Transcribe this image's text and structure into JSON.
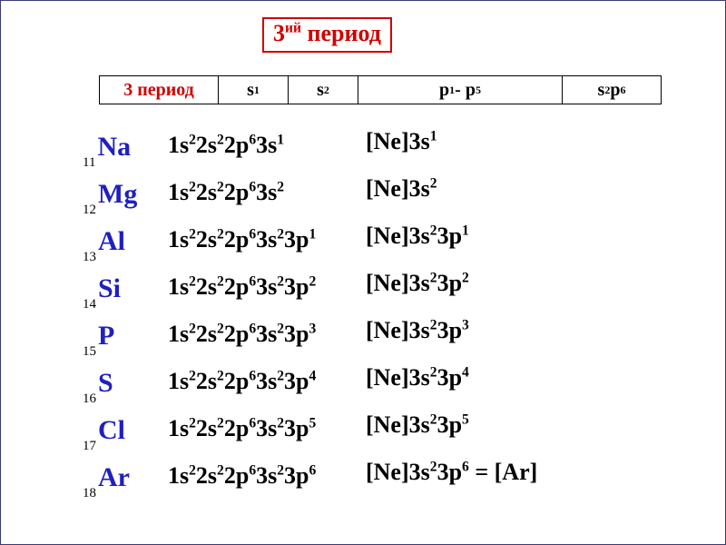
{
  "title": {
    "base": "3",
    "superscript": "ий",
    "rest": " период"
  },
  "header": {
    "period_label": "3 период",
    "cells": [
      {
        "base": "s",
        "sup": "1"
      },
      {
        "base": "s",
        "sup": "2"
      },
      {
        "text_parts": [
          {
            "t": "p",
            "sup": "1"
          },
          {
            "t": " - p",
            "sup": "5"
          }
        ]
      },
      {
        "text_parts": [
          {
            "t": "s",
            "sup": "2"
          },
          {
            "t": "p",
            "sup": "6"
          }
        ]
      }
    ]
  },
  "elements": [
    {
      "z": "11",
      "symbol": "Na",
      "full": [
        {
          "t": "1s",
          "sup": "2"
        },
        {
          "t": "2s",
          "sup": "2"
        },
        {
          "t": "2p",
          "sup": "6"
        },
        {
          "t": "3s",
          "sup": "1"
        }
      ],
      "short": [
        {
          "t": "[Ne]3s",
          "sup": "1"
        }
      ]
    },
    {
      "z": "12",
      "symbol": "Mg",
      "full": [
        {
          "t": "1s",
          "sup": "2"
        },
        {
          "t": "2s",
          "sup": "2"
        },
        {
          "t": "2p",
          "sup": "6"
        },
        {
          "t": "3s",
          "sup": "2"
        }
      ],
      "short": [
        {
          "t": "[Ne]3s",
          "sup": "2"
        }
      ]
    },
    {
      "z": "13",
      "symbol": "Al",
      "full": [
        {
          "t": "1s",
          "sup": "2"
        },
        {
          "t": "2s",
          "sup": "2"
        },
        {
          "t": "2p",
          "sup": "6"
        },
        {
          "t": "3s",
          "sup": "2"
        },
        {
          "t": "3p",
          "sup": "1"
        }
      ],
      "short": [
        {
          "t": "[Ne]3s",
          "sup": "2"
        },
        {
          "t": "3p",
          "sup": "1"
        }
      ]
    },
    {
      "z": "14",
      "symbol": "Si",
      "full": [
        {
          "t": "1s",
          "sup": "2"
        },
        {
          "t": "2s",
          "sup": "2"
        },
        {
          "t": "2p",
          "sup": "6"
        },
        {
          "t": "3s",
          "sup": "2"
        },
        {
          "t": "3p",
          "sup": "2"
        }
      ],
      "short": [
        {
          "t": "[Ne]3s",
          "sup": "2"
        },
        {
          "t": "3p",
          "sup": "2"
        }
      ]
    },
    {
      "z": "15",
      "symbol": "P",
      "full": [
        {
          "t": "1s",
          "sup": "2"
        },
        {
          "t": "2s",
          "sup": "2"
        },
        {
          "t": "2p",
          "sup": "6"
        },
        {
          "t": "3s",
          "sup": "2"
        },
        {
          "t": "3p",
          "sup": "3"
        }
      ],
      "short": [
        {
          "t": "[Ne]3s",
          "sup": "2"
        },
        {
          "t": "3p",
          "sup": "3"
        }
      ]
    },
    {
      "z": "16",
      "symbol": "S",
      "full": [
        {
          "t": "1s",
          "sup": "2"
        },
        {
          "t": "2s",
          "sup": "2"
        },
        {
          "t": "2p",
          "sup": "6"
        },
        {
          "t": "3s",
          "sup": "2"
        },
        {
          "t": "3p",
          "sup": "4"
        }
      ],
      "short": [
        {
          "t": "[Ne]3s",
          "sup": "2"
        },
        {
          "t": "3p",
          "sup": "4"
        }
      ]
    },
    {
      "z": "17",
      "symbol": "Cl",
      "full": [
        {
          "t": "1s",
          "sup": "2"
        },
        {
          "t": "2s",
          "sup": "2"
        },
        {
          "t": "2p",
          "sup": "6"
        },
        {
          "t": "3s",
          "sup": "2"
        },
        {
          "t": "3p",
          "sup": "5"
        }
      ],
      "short": [
        {
          "t": "[Ne]3s",
          "sup": "2"
        },
        {
          "t": "3p",
          "sup": "5"
        }
      ]
    },
    {
      "z": "18",
      "symbol": "Ar",
      "full": [
        {
          "t": "1s",
          "sup": "2"
        },
        {
          "t": "2s",
          "sup": "2"
        },
        {
          "t": "2p",
          "sup": "6"
        },
        {
          "t": "3s",
          "sup": "2"
        },
        {
          "t": "3p",
          "sup": "6"
        }
      ],
      "short": [
        {
          "t": "[Ne]3s",
          "sup": "2"
        },
        {
          "t": "3p",
          "sup": "6"
        },
        {
          "t": " = [Ar]"
        }
      ]
    }
  ]
}
